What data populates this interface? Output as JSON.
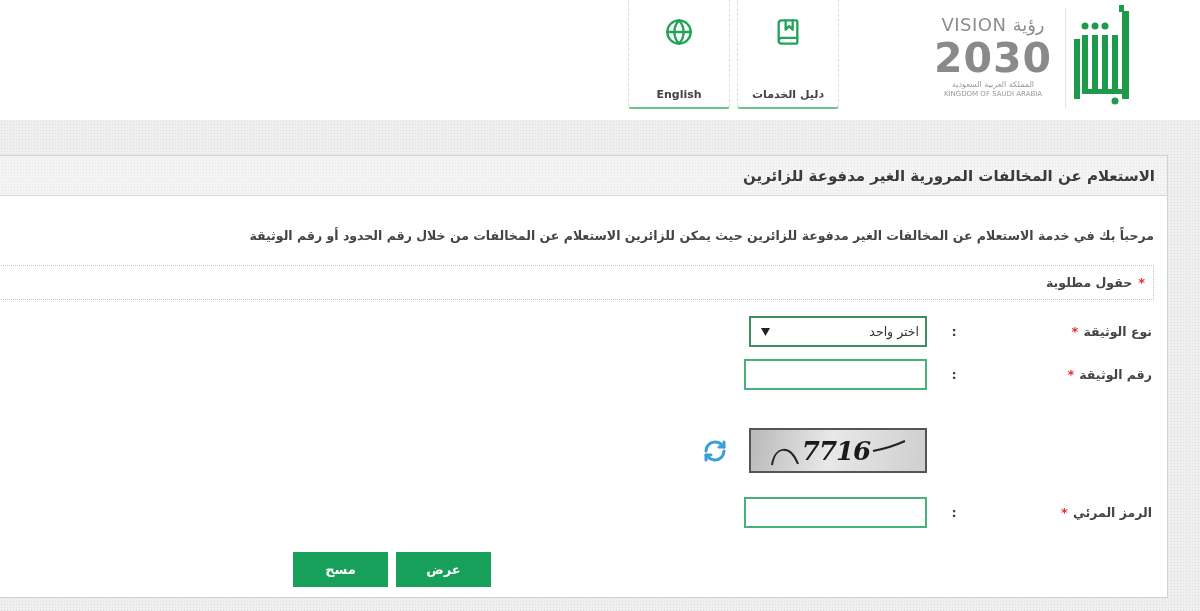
{
  "header": {
    "nav_tiles": [
      {
        "kind": "guide",
        "label": "دليل الخدمات"
      },
      {
        "kind": "language",
        "label": "English"
      }
    ],
    "vision_logo": {
      "vision": "VISION",
      "vision_ar": "رؤية",
      "year": "2030",
      "country_ar": "المملكة العربية السعودية",
      "country_en": "KINGDOM OF SAUDI ARABIA"
    }
  },
  "panel": {
    "title": "الاستعلام عن المخالفات المرورية الغير مدفوعة للزائرين",
    "intro": "مرحباً بك في خدمة الاستعلام عن المخالفات الغير مدفوعة للزائرين حيث يمكن للزائرين الاستعلام عن المخالفات من خلال رقم الحدود أو رقم الوثيقة",
    "required_note": {
      "mark": "*",
      "text": "حقول مطلوبة"
    },
    "fields": [
      {
        "kind": "select",
        "label": "نوع الوثيقة",
        "required": true,
        "mark": "*",
        "separator": ":",
        "value": "اختر واحد"
      },
      {
        "kind": "text",
        "label": "رقم الوثيقة",
        "required": true,
        "mark": "*",
        "separator": ":"
      },
      {
        "kind": "captcha",
        "code": "7716"
      },
      {
        "kind": "text",
        "label": "الرمز المرئي",
        "required": true,
        "mark": "*",
        "separator": ":"
      }
    ],
    "buttons": [
      {
        "label": "عرض"
      },
      {
        "label": "مسح"
      }
    ]
  }
}
